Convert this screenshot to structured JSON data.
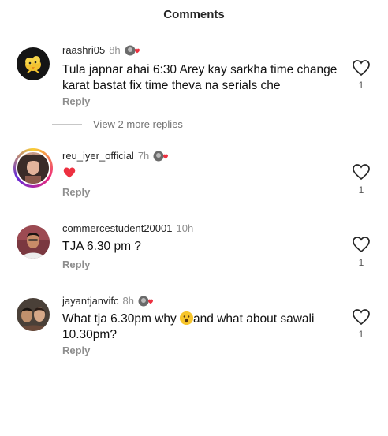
{
  "header": {
    "title": "Comments"
  },
  "comments": [
    {
      "username": "raashri05",
      "time": "8h",
      "text": "Tula japnar ahai 6:30  Arey kay sarkha time change karat bastat fix time theva na serials che",
      "reply_label": "Reply",
      "like_count": "1",
      "more_replies": "View 2 more replies"
    },
    {
      "username": "reu_iyer_official",
      "time": "7h",
      "text_emoji": "red-heart",
      "reply_label": "Reply",
      "like_count": "1"
    },
    {
      "username": "commercestudent20001",
      "time": "10h",
      "text": "TJA 6.30 pm ?",
      "reply_label": "Reply",
      "like_count": "1"
    },
    {
      "username": "jayantjanvifc",
      "time": "8h",
      "text_before": "What tja 6.30pm why ",
      "text_after": "and what about sawali 10.30pm?",
      "text_emoji": "astonished-face",
      "reply_label": "Reply",
      "like_count": "1"
    }
  ],
  "colors": {
    "heart": "#ed3040",
    "muted": "#8e8e8e"
  }
}
